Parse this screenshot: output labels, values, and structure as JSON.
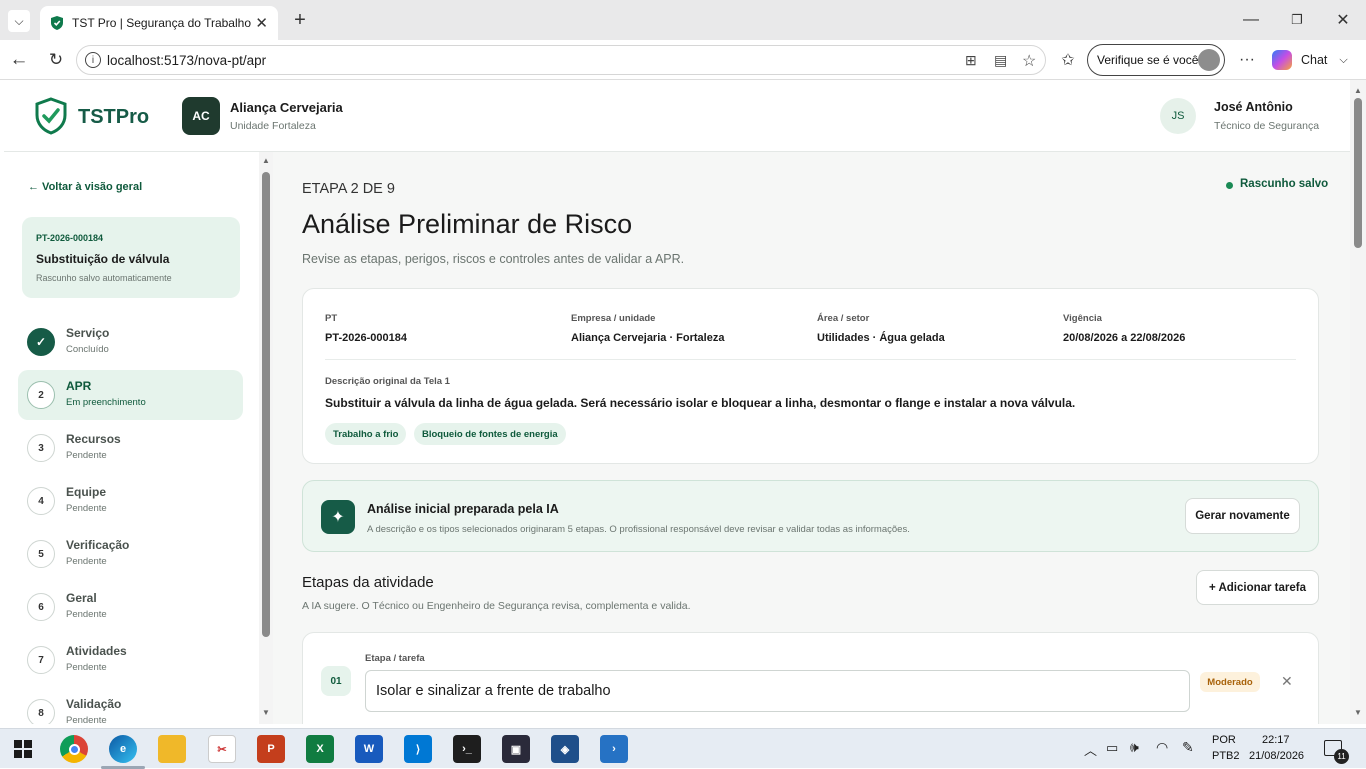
{
  "browser": {
    "tab_title": "TST Pro | Segurança do Trabalho",
    "url": "localhost:5173/nova-pt/apr",
    "profile_label": "Verifique se é você",
    "chat_label": "Chat"
  },
  "header": {
    "logo_text": "TSTPro",
    "company_initials": "AC",
    "company_name": "Aliança Cervejaria",
    "company_unit": "Unidade Fortaleza",
    "user_initials": "JS",
    "user_name": "José Antônio",
    "user_role": "Técnico de Segurança"
  },
  "sidebar": {
    "back_link": "← Voltar à visão geral",
    "doc_id": "PT-2026-000184",
    "doc_title": "Substituição de válvula",
    "doc_status": "Rascunho salvo automaticamente",
    "steps": [
      {
        "num": "✓",
        "name": "Serviço",
        "status": "Concluído"
      },
      {
        "num": "2",
        "name": "APR",
        "status": "Em preenchimento"
      },
      {
        "num": "3",
        "name": "Recursos",
        "status": "Pendente"
      },
      {
        "num": "4",
        "name": "Equipe",
        "status": "Pendente"
      },
      {
        "num": "5",
        "name": "Verificação",
        "status": "Pendente"
      },
      {
        "num": "6",
        "name": "Geral",
        "status": "Pendente"
      },
      {
        "num": "7",
        "name": "Atividades",
        "status": "Pendente"
      },
      {
        "num": "8",
        "name": "Validação",
        "status": "Pendente"
      }
    ]
  },
  "main": {
    "step_label": "ETAPA 2 DE 9",
    "save_status": "Rascunho salvo",
    "title": "Análise Preliminar de Risco",
    "subtitle": "Revise as etapas, perigos, riscos e controles antes de validar a APR.",
    "summary": {
      "pt_label": "PT",
      "pt_value": "PT-2026-000184",
      "company_label": "Empresa / unidade",
      "company_value": "Aliança Cervejaria · Fortaleza",
      "area_label": "Área / setor",
      "area_value": "Utilidades · Água gelada",
      "validity_label": "Vigência",
      "validity_value": "20/08/2026 a 22/08/2026",
      "desc_label": "Descrição original da Tela 1",
      "desc_value": "Substituir a válvula da linha de água gelada. Será necessário isolar e bloquear a linha, desmontar o flange e instalar a nova válvula.",
      "tags": [
        "Trabalho a frio",
        "Bloqueio de fontes de energia"
      ]
    },
    "ai_banner": {
      "title": "Análise inicial preparada pela IA",
      "text": "A descrição e os tipos selecionados originaram 5 etapas. O profissional responsável deve revisar e validar todas as informações.",
      "button": "Gerar novamente"
    },
    "activities": {
      "title": "Etapas da atividade",
      "subtitle": "A IA sugere. O Técnico ou Engenheiro de Segurança revisa, complementa e valida.",
      "add_button": "+ Adicionar tarefa"
    },
    "task": {
      "number": "01",
      "label": "Etapa / tarefa",
      "value": "Isolar e sinalizar a frente de trabalho",
      "risk": "Moderado"
    }
  },
  "taskbar": {
    "lang1": "POR",
    "lang2": "PTB2",
    "time": "22:17",
    "date": "21/08/2026",
    "notifications": "11"
  },
  "colors": {
    "brand": "#0f5a3c",
    "accent_bg": "#e6f3ec",
    "risk_bg": "#fdf1dc",
    "risk_text": "#a8620a"
  }
}
